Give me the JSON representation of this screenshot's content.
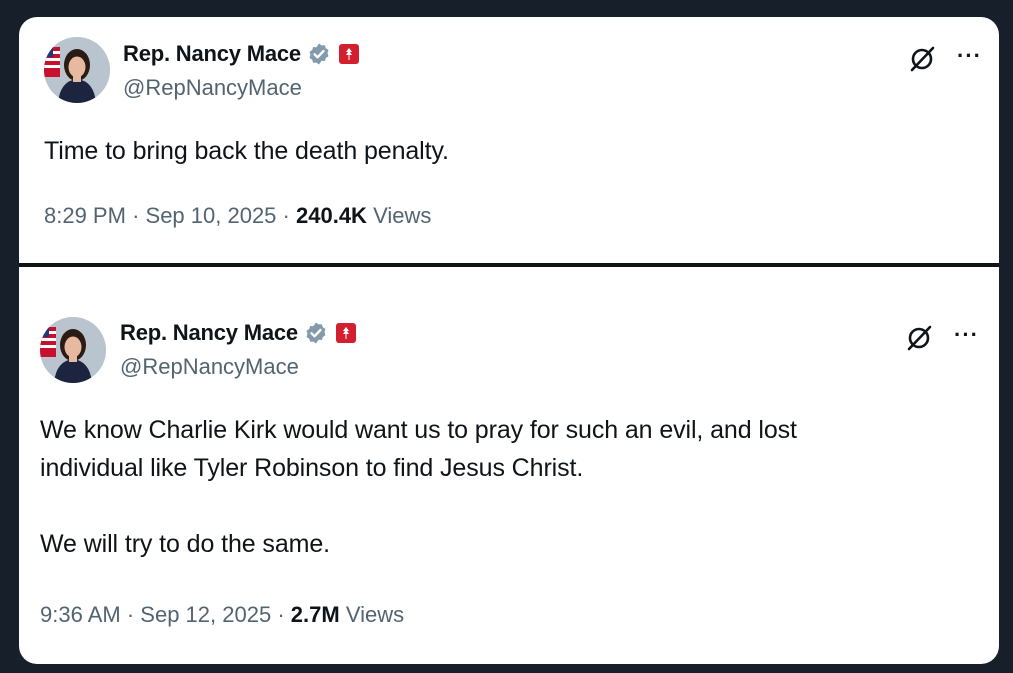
{
  "tweets": [
    {
      "name": "Rep. Nancy Mace",
      "handle": "@RepNancyMace",
      "text": "Time to bring back the death penalty.",
      "time": "8:29 PM",
      "date": "Sep 10, 2025",
      "views_count": "240.4K",
      "views_label": "Views",
      "separator": "·",
      "more_label": "···"
    },
    {
      "name": "Rep. Nancy Mace",
      "handle": "@RepNancyMace",
      "text": "We know Charlie Kirk would want us to pray for such an evil, and lost\nindividual like Tyler Robinson to find Jesus Christ.\n\nWe will try to do the same.",
      "time": "9:36 AM",
      "date": "Sep 12, 2025",
      "views_count": "2.7M",
      "views_label": "Views",
      "separator": "·",
      "more_label": "···"
    }
  ],
  "icons": {
    "verified": "verified-badge-icon",
    "affiliate": "flag-badge-icon",
    "grok": "grok-icon",
    "more": "more-icon"
  },
  "colors": {
    "background": "#17202a",
    "card": "#ffffff",
    "primary_text": "#0f1419",
    "secondary_text": "#536471",
    "verified": "#829aab",
    "badge": "#d2202f"
  }
}
